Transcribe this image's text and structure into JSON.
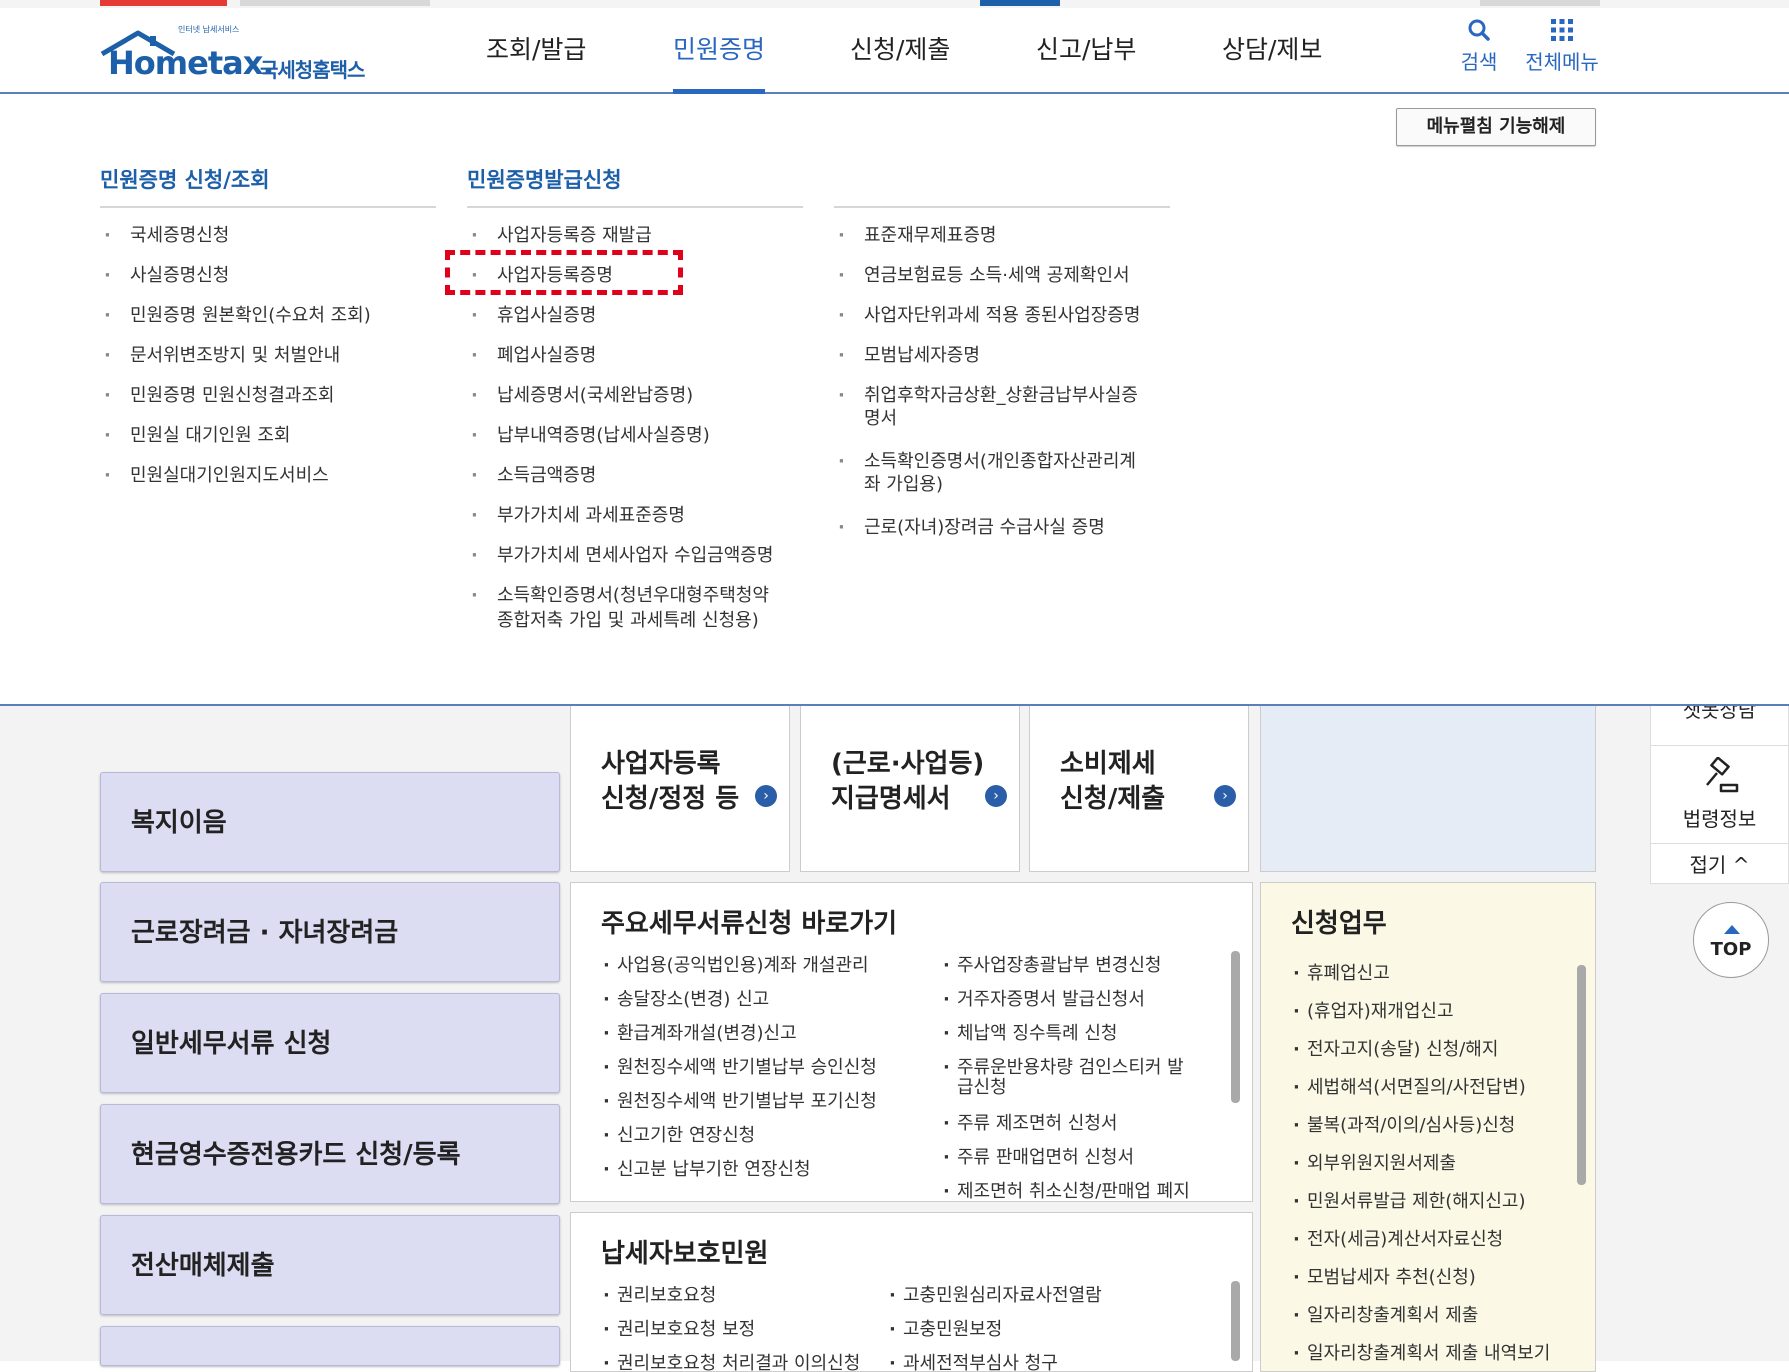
{
  "header": {
    "logo_tagline": "인터넷 납세서비스",
    "logo_main": "Hometax.",
    "logo_kr": "국세청홈택스",
    "nav": [
      "조회/발급",
      "민원증명",
      "신청/제출",
      "신고/납부",
      "상담/제보"
    ],
    "active_nav": "민원증명",
    "search_label": "검색",
    "allmenu_label": "전체메뉴"
  },
  "mega": {
    "menufix_button": "메뉴펼침 기능해제",
    "col1_title": "민원증명 신청/조회",
    "col2_title": "민원증명발급신청",
    "col1_items": [
      "국세증명신청",
      "사실증명신청",
      "민원증명 원본확인(수요처 조회)",
      "문서위변조방지 및 처벌안내",
      "민원증명 민원신청결과조회",
      "민원실 대기인원 조회",
      "민원실대기인원지도서비스"
    ],
    "col2_items": [
      "사업자등록증 재발급",
      "사업자등록증명",
      "휴업사실증명",
      "폐업사실증명",
      "납세증명서(국세완납증명)",
      "납부내역증명(납세사실증명)",
      "소득금액증명",
      "부가가치세 과세표준증명",
      "부가가치세 면세사업자 수입금액증명",
      "소득확인증명서(청년우대형주택청약",
      "종합저축 가입 및 과세특례 신청용)"
    ],
    "col3_items": [
      "표준재무제표증명",
      "연금보험료등 소득·세액 공제확인서",
      "사업자단위과세 적용 종된사업장증명",
      "모범납세자증명",
      "취업후학자금상환_상환금납부사실증",
      "명서",
      "소득확인증명서(개인종합자산관리계",
      "좌 가입용)",
      "근로(자녀)장려금 수급사실 증명"
    ]
  },
  "content": {
    "left_boxes": [
      "복지이음",
      "근로장려금 · 자녀장려금",
      "일반세무서류 신청",
      "현금영수증전용카드 신청/등록",
      "전산매체제출"
    ],
    "tiles": [
      "사업자등록\n신청/정정 등",
      "(근로·사업등)\n지급명세서",
      "소비제세\n신청/제출"
    ],
    "tile_go_icon": "›",
    "shortcut_title": "주요세무서류신청 바로가기",
    "shortcut_left": [
      "사업용(공익법인용)계좌 개설관리",
      "송달장소(변경) 신고",
      "환급계좌개설(변경)신고",
      "원천징수세액 반기별납부 승인신청",
      "원천징수세액 반기별납부 포기신청",
      "신고기한 연장신청",
      "신고분 납부기한 연장신청"
    ],
    "shortcut_right": [
      "주사업장총괄납부 변경신청",
      "거주자증명서 발급신청서",
      "체납액 징수특례 신청",
      "주류운반용차량 검인스티커 발",
      "급신청",
      "주류 제조면허 신청서",
      "주류 판매업면허 신청서",
      "제조면허 취소신청/판매업 폐지"
    ],
    "protect_title": "납세자보호민원",
    "protect_left": [
      "권리보호요청",
      "권리보호요청 보정",
      "권리보호요청 처리결과 이의신청"
    ],
    "protect_right": [
      "고충민원심리자료사전열람",
      "고충민원보정",
      "과세전적부심사 청구"
    ],
    "apply_title": "신청업무",
    "apply_items": [
      "휴폐업신고",
      "(휴업자)재개업신고",
      "전자고지(송달) 신청/해지",
      "세법해석(서면질의/사전답변)",
      "불복(과적/이의/심사등)신청",
      "외부위원지원서제출",
      "민원서류발급 제한(해지신고)",
      "전자(세금)계산서자료신청",
      "모범납세자 추천(신청)",
      "일자리창출계획서 제출",
      "일자리창출계획서 제출 내역보기"
    ]
  },
  "side": {
    "top_cut_label": "챗봇상담",
    "law_label": "법령정보",
    "fold_label": "접기 ^",
    "top_label": "TOP"
  },
  "colors": {
    "brand": "#1d5fa8",
    "active": "#2a67c1",
    "highlight": "#e0001b"
  }
}
